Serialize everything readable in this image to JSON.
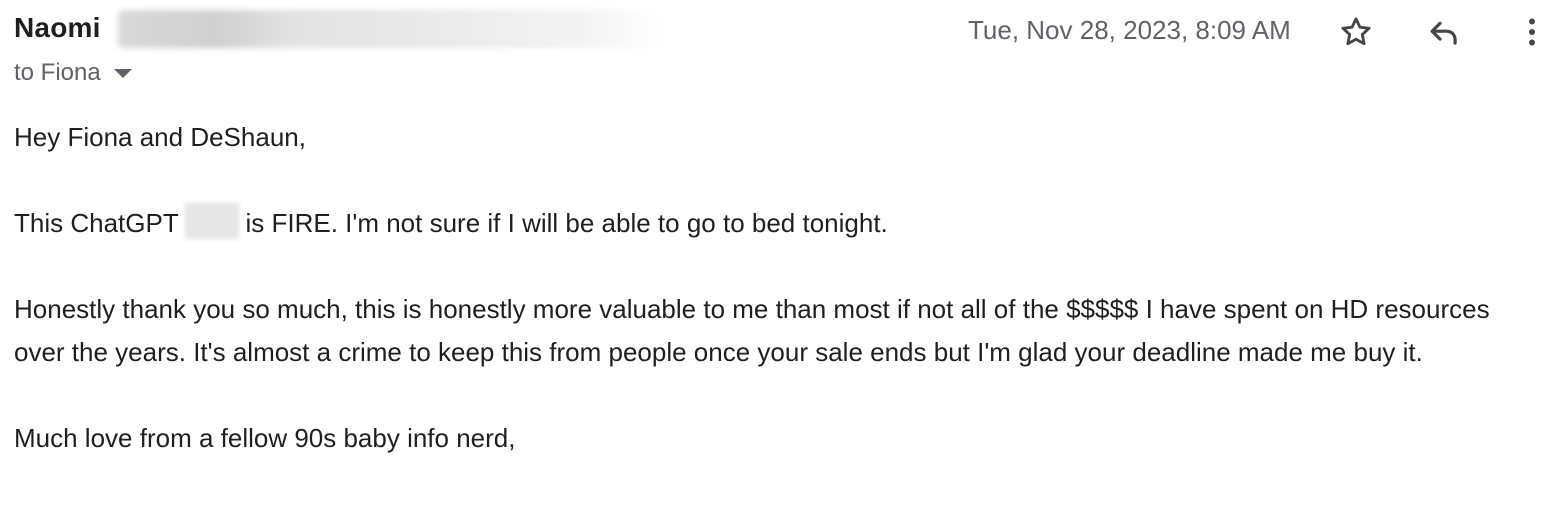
{
  "email": {
    "sender_name": "Naomi",
    "date": "Tue, Nov 28, 2023, 8:09 AM",
    "recipient_line": "to Fiona",
    "actions": {
      "star_icon": "star-outline-icon",
      "reply_icon": "reply-icon",
      "more_icon": "more-vert-icon",
      "recipient_dropdown_icon": "caret-down-icon"
    },
    "body": {
      "greeting": "Hey Fiona and DeShaun,",
      "p1_before": "This ChatGPT",
      "p1_after": "is FIRE. I'm not sure if I will be able to go to bed tonight.",
      "p2": "Honestly thank you so much, this is honestly more valuable to me than most if not all of the $$$$$ I have spent on HD resources over the years. It's almost a crime to keep this from people once your sale ends but I'm glad your deadline made me buy it.",
      "closing": "Much love from a fellow 90s baby info nerd,"
    }
  },
  "colors": {
    "text": "#1f1f1f",
    "muted": "#5f6368",
    "icon": "#444746"
  }
}
